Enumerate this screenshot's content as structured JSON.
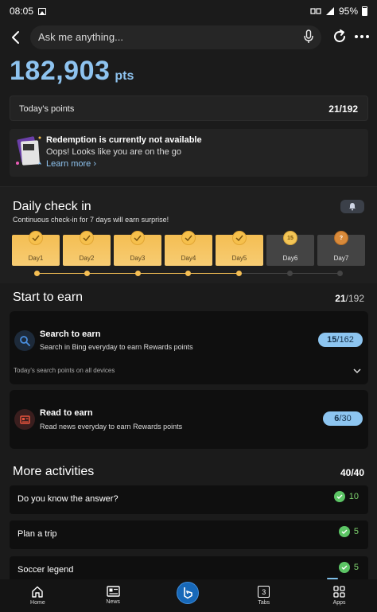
{
  "status": {
    "time": "08:05",
    "battery": "95%"
  },
  "topbar": {
    "placeholder": "Ask me anything..."
  },
  "points": {
    "value": "182,903",
    "unit": "pts"
  },
  "today": {
    "label": "Today's points",
    "value": "21/192"
  },
  "redeem": {
    "title": "Redemption is currently not available",
    "subtitle": "Oops! Looks like you are on the go",
    "link": "Learn more"
  },
  "daily": {
    "title": "Daily check in",
    "subtitle": "Continuous check-in for 7 days will earn surprise!",
    "days": [
      {
        "label": "Day1",
        "done": true
      },
      {
        "label": "Day2",
        "done": true
      },
      {
        "label": "Day3",
        "done": true
      },
      {
        "label": "Day4",
        "done": true
      },
      {
        "label": "Day5",
        "done": true
      },
      {
        "label": "Day6",
        "done": false,
        "coin": "15"
      },
      {
        "label": "Day7",
        "done": false,
        "coin": "?"
      }
    ]
  },
  "earn": {
    "title": "Start to earn",
    "value_current": "21",
    "value_total": "/192",
    "search": {
      "title": "Search to earn",
      "desc": "Search in Bing everyday to earn Rewards points",
      "current": "15",
      "total": "/162",
      "footer": "Today's search points on all devices"
    },
    "read": {
      "title": "Read to earn",
      "desc": "Read news everyday to earn Rewards points",
      "current": "6",
      "total": "/30"
    }
  },
  "activities": {
    "title": "More activities",
    "value": "40/40",
    "items": [
      {
        "label": "Do you know the answer?",
        "points": "10"
      },
      {
        "label": "Plan a trip",
        "points": "5"
      },
      {
        "label": "Soccer legend",
        "points": "5"
      }
    ]
  },
  "nav": {
    "home": "Home",
    "news": "News",
    "tabs": "Tabs",
    "tabs_count": "3",
    "apps": "Apps"
  },
  "colors": {
    "accent": "#8ec3ef",
    "gold": "#f4be53",
    "green": "#5cc565"
  }
}
